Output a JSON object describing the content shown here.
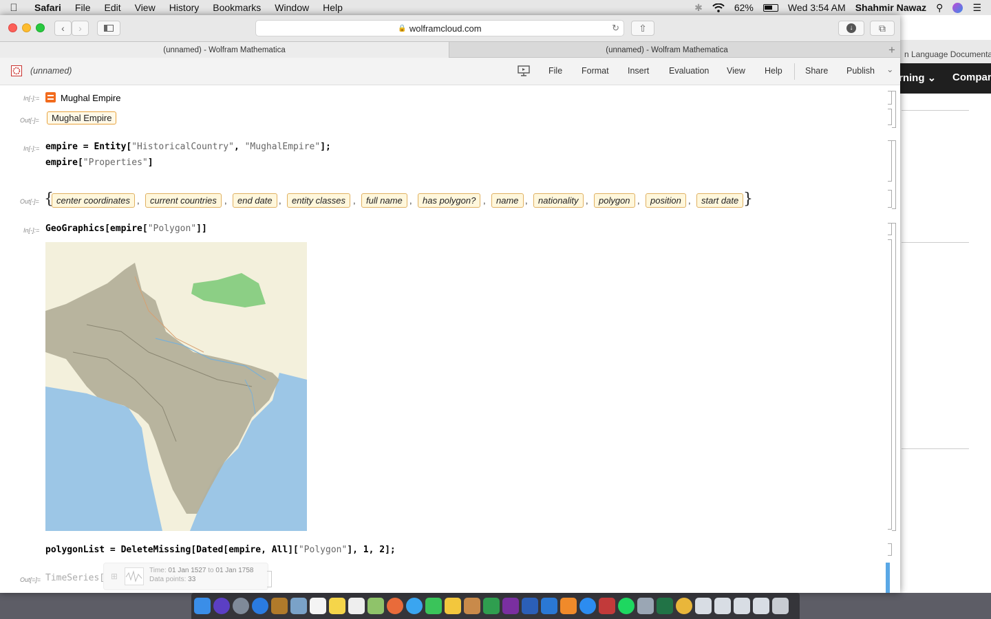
{
  "menubar": {
    "app": "Safari",
    "items": [
      "File",
      "Edit",
      "View",
      "History",
      "Bookmarks",
      "Window",
      "Help"
    ],
    "battery": "62%",
    "clock": "Wed 3:54 AM",
    "user": "Shahmir Nawaz"
  },
  "browser": {
    "url": "wolframcloud.com",
    "tabs": [
      "(unnamed) - Wolfram Mathematica",
      "(unnamed) - Wolfram Mathematica"
    ],
    "new_tab": "+"
  },
  "background_window": {
    "tab_text": "n Language Documentatio",
    "nav_items": [
      "rning ⌄",
      "Compan"
    ]
  },
  "app": {
    "notebook_name": "(unnamed)",
    "menu": [
      "File",
      "Format",
      "Insert",
      "Evaluation",
      "View",
      "Help"
    ],
    "share": "Share",
    "publish": "Publish"
  },
  "notebook": {
    "in_label": "In[-]:=",
    "out_label": "Out[-]=",
    "cell1_input": "Mughal Empire",
    "cell1_output": "Mughal Empire",
    "cell2_line1_a": "empire = Entity[",
    "cell2_line1_s1": "\"HistoricalCountry\"",
    "cell2_line1_b": ", ",
    "cell2_line1_s2": "\"MughalEmpire\"",
    "cell2_line1_c": "];",
    "cell2_line2_a": "empire[",
    "cell2_line2_s": "\"Properties\"",
    "cell2_line2_b": "]",
    "properties": [
      "center coordinates",
      "current countries",
      "end date",
      "entity classes",
      "full name",
      "has polygon?",
      "name",
      "nationality",
      "polygon",
      "position",
      "start date"
    ],
    "brace_open": "{",
    "brace_close": "}",
    "comma": ",",
    "cell3_a": "GeoGraphics[empire[",
    "cell3_s": "\"Polygon\"",
    "cell3_b": "]]",
    "cell4_a": "polygonList = DeleteMissing[Dated[empire, All][",
    "cell4_s": "\"Polygon\"",
    "cell4_b": "], 1, 2];",
    "cell5_label": "Out[=]=",
    "timeseries": "TimeSeries[",
    "ts_time_label": "Time:",
    "ts_time_from": "01 Jan 1527",
    "ts_to": "to",
    "ts_time_to": "01 Jan 1758",
    "ts_points_label": "Data points:",
    "ts_points": "33"
  },
  "colors": {
    "map_water": "#9cc6e6",
    "map_land": "#f3f0dc",
    "map_empire": "#b4b09a",
    "map_forest": "#8ccf85",
    "entity_border": "#e8a33d"
  }
}
